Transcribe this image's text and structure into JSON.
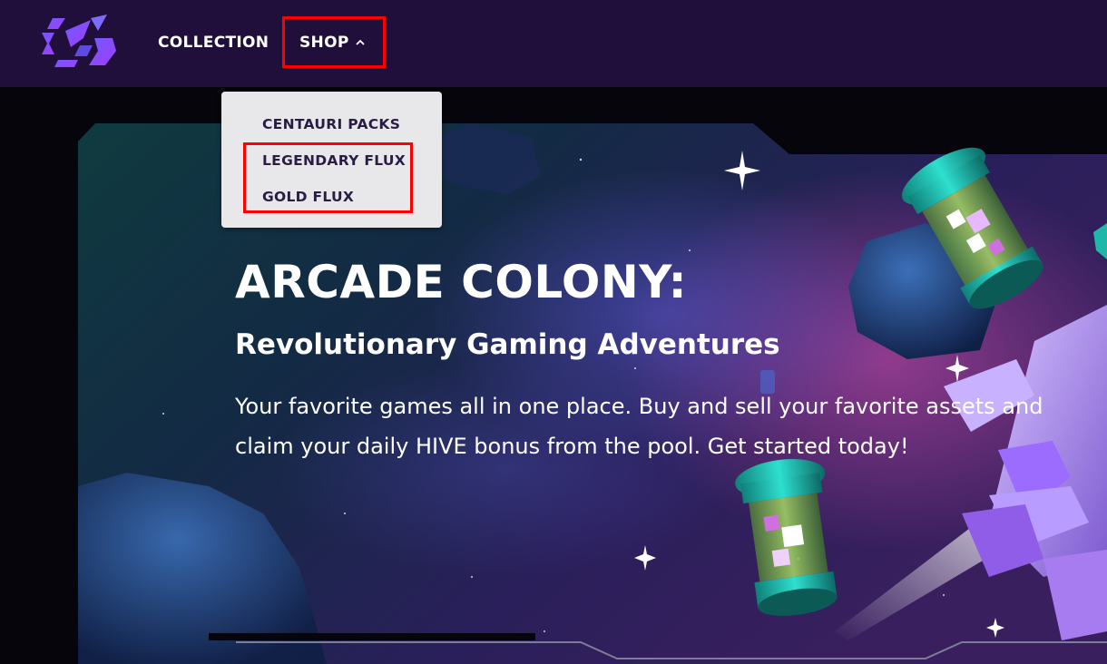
{
  "nav": {
    "logo_icon": "gamepad-rocket-logo-icon",
    "items": [
      {
        "label": "COLLECTION"
      },
      {
        "label": "SHOP",
        "icon": "chevron-up-icon",
        "expanded": true
      }
    ]
  },
  "shop_menu": {
    "items": [
      {
        "label": "CENTAURI PACKS"
      },
      {
        "label": "LEGENDARY FLUX"
      },
      {
        "label": "GOLD FLUX"
      }
    ]
  },
  "hero": {
    "title": "ARCADE COLONY:",
    "subtitle": "Revolutionary Gaming Adventures",
    "description": "Your favorite games all in one place. Buy and sell your favorite assets and claim your daily HIVE bonus from the pool. Get started today!"
  },
  "annotations": {
    "highlight_color": "#ff0000"
  },
  "colors": {
    "navbar_bg": "#1f0f3a",
    "dropdown_bg": "#e8e8ea",
    "dropdown_text": "#2a1d45",
    "accent_purple": "#8a4cff",
    "accent_teal": "#1fb8a8"
  }
}
